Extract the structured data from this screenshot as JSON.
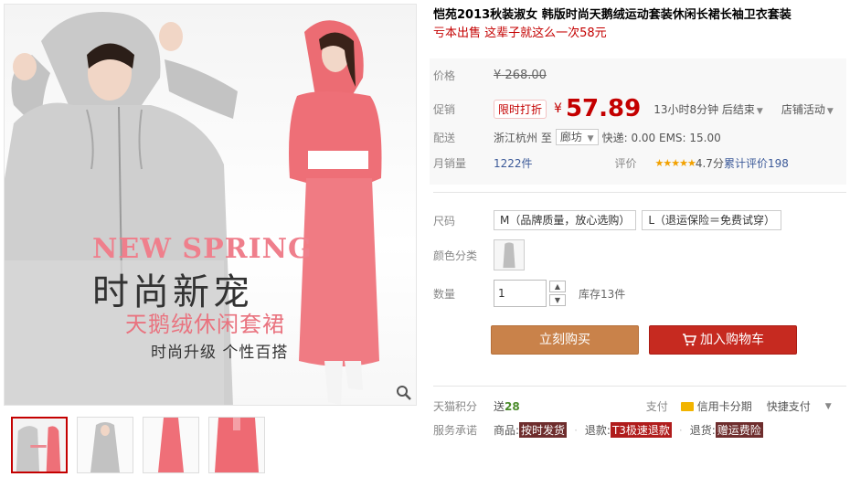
{
  "product": {
    "title": "恺苑2013秋装淑女 韩版时尚天鹅绒运动套装休闲长裙长袖卫衣套装",
    "subtitle": "亏本出售 这辈子就这么一次58元"
  },
  "promo_image": {
    "headline_en": "NEW SPRING",
    "headline_cn": "时尚新宠",
    "line2": "天鹅绒休闲套裙",
    "line3": "时尚升级 个性百搭"
  },
  "price": {
    "original_label": "价格",
    "original_symbol": "¥",
    "original_value": "268.00",
    "promo_label": "促销",
    "promo_badge": "限时打折",
    "promo_symbol": "¥",
    "promo_value": "57.89",
    "countdown": "13小时8分钟 后结束",
    "shop_event": "店铺活动"
  },
  "shipping": {
    "label": "配送",
    "from": "浙江杭州 至",
    "to": "廊坊",
    "fee": "快递: 0.00 EMS: 15.00"
  },
  "sales": {
    "label": "月销量",
    "value": "1222件",
    "rating_label": "评价",
    "stars": "★★★★★",
    "score": "4.7分",
    "reviews": "累计评价198"
  },
  "sku": {
    "size_label": "尺码",
    "sizes": [
      "M（品牌质量，放心选购）",
      "L（退运保险＝免费试穿）"
    ],
    "color_label": "颜色分类",
    "qty_label": "数量",
    "qty_value": "1",
    "qty_up": "▲",
    "qty_down": "▼",
    "stock": "库存13件"
  },
  "actions": {
    "buy_now": "立刻购买",
    "add_cart": "加入购物车"
  },
  "points": {
    "label": "天猫积分",
    "send": "送",
    "value": "28",
    "pay_label": "支付",
    "card_installment": "信用卡分期",
    "quick_pay": "快捷支付"
  },
  "service": {
    "label": "服务承诺",
    "goods_label": "商品:",
    "goods_tag": "按时发货",
    "refund_label": "退款:",
    "refund_tag": "T3极速退款",
    "return_label": "退货:",
    "return_tag": "赠运费险"
  },
  "colors": {
    "accent_red": "#c40000",
    "buy_button": "#c9824a",
    "cart_button": "#c62a20"
  }
}
